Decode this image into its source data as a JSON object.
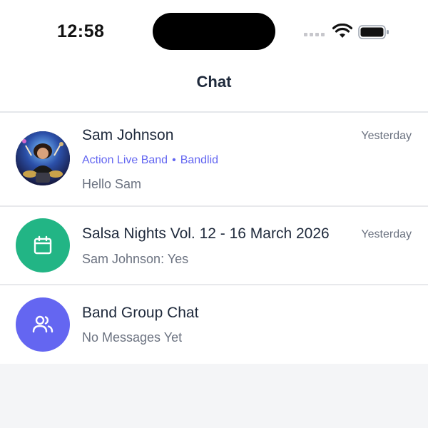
{
  "status_bar": {
    "time": "12:58",
    "icons": [
      "cellular-signal-icon",
      "wifi-icon",
      "battery-icon"
    ]
  },
  "header": {
    "title": "Chat"
  },
  "chats": [
    {
      "name": "Sam Johnson",
      "time": "Yesterday",
      "subtitle_group": "Action Live Band",
      "subtitle_separator": "•",
      "subtitle_role": "Bandlid",
      "preview": "Hello Sam",
      "avatar": "drummer-photo"
    },
    {
      "name": "Salsa Nights Vol. 12 - 16 March 2026",
      "time": "Yesterday",
      "preview": "Sam Johnson: Yes",
      "avatar": "calendar-icon",
      "avatar_color": "#22b585"
    },
    {
      "name": "Band Group Chat",
      "preview": "No Messages Yet",
      "avatar": "group-icon",
      "avatar_color": "#6466f1"
    }
  ],
  "colors": {
    "accent": "#6366f1",
    "event_green": "#22b585",
    "group_purple": "#6466f1",
    "muted_text": "#6b7280",
    "background": "#f4f5f7"
  }
}
